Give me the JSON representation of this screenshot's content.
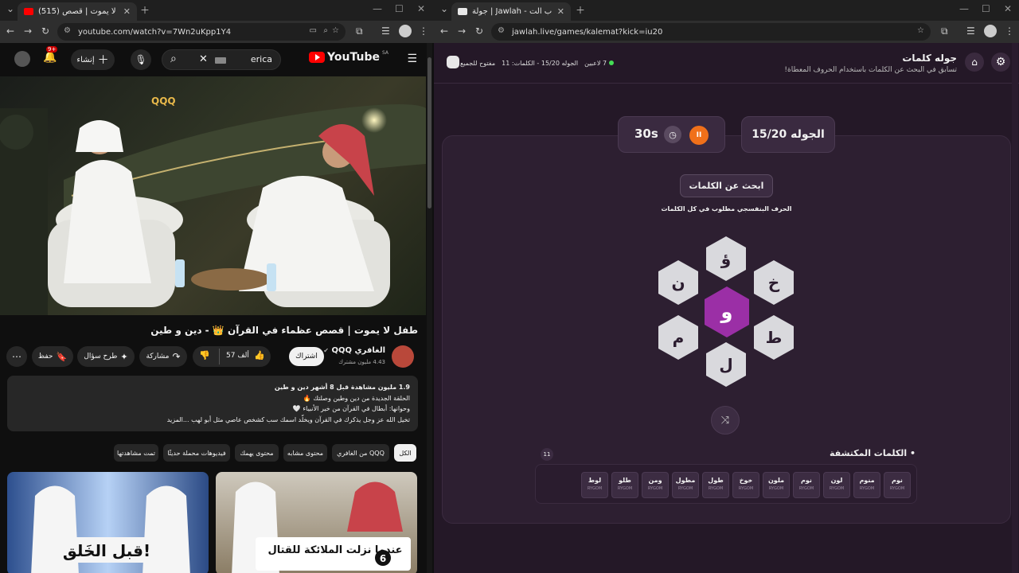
{
  "left_window": {
    "tab_title": "(515) طفل لا يموت | قصص...",
    "url": "youtube.com/watch?v=7Wn2uKpp1Y4",
    "youtube": {
      "logo_text": "YouTube",
      "logo_region": "SA",
      "search_query": "erica",
      "create_label": "إنشاء",
      "notification_badge": "9+",
      "video_title": "طفل لا يموت | قصص عظماء في القرآن 👑 - دين و طين",
      "channel_name": "الغافري QQQ",
      "subscribers": "4.43 مليون مشترك",
      "subscribe_label": "اشتراك",
      "like_count": "57 ألف",
      "share_label": "مشاركة",
      "ask_label": "طرح سؤال",
      "save_label": "حفظ",
      "description": {
        "meta": "1.9 مليون مشاهدة  قبل 8 أشهر  دين و طين",
        "line1": "الحلقة الجديدة من دين وطين وصلتك 🔥",
        "line2": "وحوانها: أبطال في القرآن من خير الأنبياء 🤍",
        "line3": "تخيل الله عز وجل يذكرك في القرآن ويخلّد اسمك سب كشخص عاصي مثل أبو لهب ...المزيد"
      },
      "chips": [
        "الكل",
        "من الغافري QQQ",
        "محتوى مشابه",
        "محتوى يهمك",
        "فيديوهات محملة حديثًا",
        "تمت مشاهدتها"
      ],
      "thumbnails": [
        {
          "caption": "قبل الخَلق!"
        },
        {
          "caption": "عندما نزلت الملائكة للقتال",
          "badge": "6"
        }
      ]
    }
  },
  "right_window": {
    "tab_title": "جولة | Jawlah - منصة الألعاب الت...",
    "url": "jawlah.live/games/kalemat?kick=iu20",
    "app": {
      "title": "جوله كلمات",
      "subtitle": "تسابق في البحث عن الكلمات باستخدام الحروف المعطاة!",
      "players": "7 لاعبين",
      "round_words": "الجوله 15/20 - الكلمات: 11",
      "open_label": "مفتوح للجميع",
      "round_label": "الجوله 15/20",
      "timer": "30s",
      "pause_icon": "II",
      "find_words_label": "ابحث عن الكلمات",
      "hint": "الحرف البنفسجي مطلوب في كل الكلمات",
      "letters": {
        "center": "و",
        "top": "ؤ",
        "top_right": "خ",
        "bottom_right": "ط",
        "bottom": "ل",
        "bottom_left": "م",
        "top_left": "ن"
      },
      "found_title": "• الكلمات المكتشفة",
      "found_count": "11",
      "words": [
        {
          "w": "نوم",
          "by": "RYGOM"
        },
        {
          "w": "منوم",
          "by": "RYGOM"
        },
        {
          "w": "لون",
          "by": "RYGOM"
        },
        {
          "w": "نوم",
          "by": "RYGOM"
        },
        {
          "w": "ملون",
          "by": "RYGOM"
        },
        {
          "w": "خوخ",
          "by": "RYGOM"
        },
        {
          "w": "طول",
          "by": "RYGOM"
        },
        {
          "w": "مطول",
          "by": "RYGOM"
        },
        {
          "w": "ومن",
          "by": "RYGOM"
        },
        {
          "w": "طلو",
          "by": "RYGOM"
        },
        {
          "w": "لوط",
          "by": "RYGOM"
        }
      ],
      "accent_color": "#9b2fa6",
      "timer_color": "#f0701a"
    }
  }
}
